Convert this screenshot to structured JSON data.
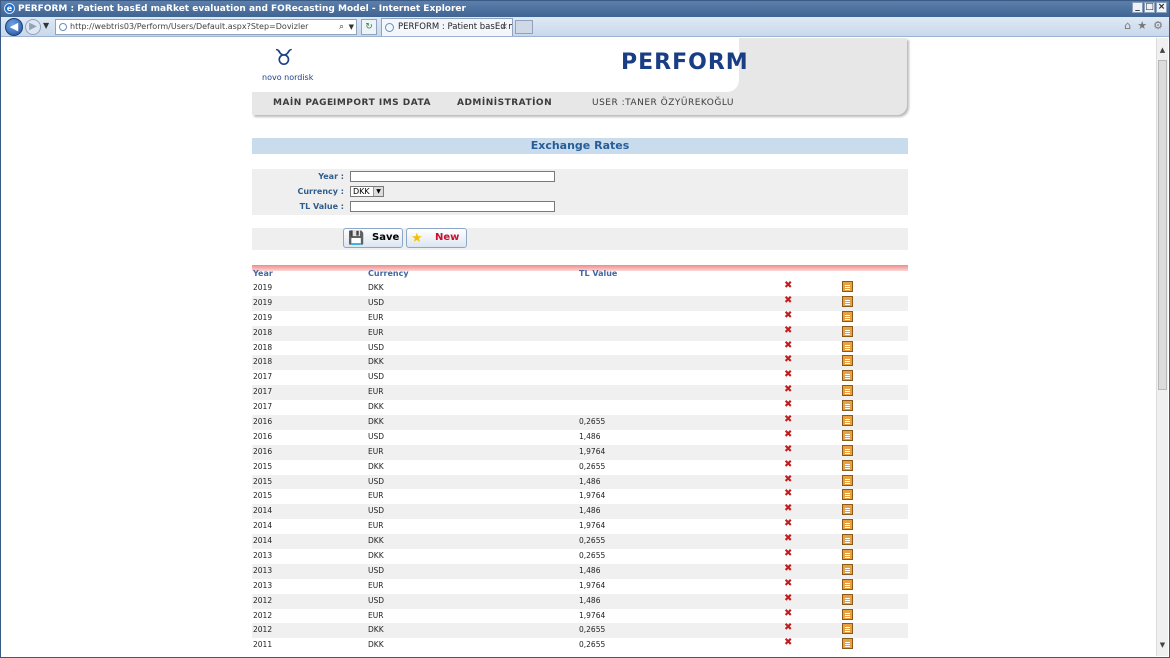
{
  "window": {
    "title": "PERFORM : Patient basEd maRket evaluation and FORecasting Model - Internet Explorer",
    "controls": [
      "_",
      "□",
      "×"
    ]
  },
  "browser": {
    "address": "http://webtris03/Perform/Users/Default.aspx?Step=Dovizler",
    "tab_title": "PERFORM : Patient basEd m...",
    "tab_close": "×"
  },
  "header": {
    "logo_brand": "novo nordisk",
    "app_name": "PERFORM",
    "menu": {
      "main_page": "MAİN PAGE",
      "import_ims": "IMPORT IMS DATA",
      "administration": "ADMİNİSTRATİON",
      "user": "USER :TANER ÖZYÜREKOĞLU"
    }
  },
  "section": {
    "title": "Exchange Rates"
  },
  "form": {
    "year_label": "Year :",
    "year_value": "",
    "currency_label": "Currency :",
    "currency_value": "DKK",
    "tl_label": "TL Value :",
    "tl_value": "",
    "save_label": "Save",
    "new_label": "New"
  },
  "table": {
    "columns": [
      "Year",
      "Currency",
      "TL Value"
    ],
    "rows": [
      {
        "year": "2019",
        "currency": "DKK",
        "tl": ""
      },
      {
        "year": "2019",
        "currency": "USD",
        "tl": ""
      },
      {
        "year": "2019",
        "currency": "EUR",
        "tl": ""
      },
      {
        "year": "2018",
        "currency": "EUR",
        "tl": ""
      },
      {
        "year": "2018",
        "currency": "USD",
        "tl": ""
      },
      {
        "year": "2018",
        "currency": "DKK",
        "tl": ""
      },
      {
        "year": "2017",
        "currency": "USD",
        "tl": ""
      },
      {
        "year": "2017",
        "currency": "EUR",
        "tl": ""
      },
      {
        "year": "2017",
        "currency": "DKK",
        "tl": ""
      },
      {
        "year": "2016",
        "currency": "DKK",
        "tl": "0,2655"
      },
      {
        "year": "2016",
        "currency": "USD",
        "tl": "1,486"
      },
      {
        "year": "2016",
        "currency": "EUR",
        "tl": "1,9764"
      },
      {
        "year": "2015",
        "currency": "DKK",
        "tl": "0,2655"
      },
      {
        "year": "2015",
        "currency": "USD",
        "tl": "1,486"
      },
      {
        "year": "2015",
        "currency": "EUR",
        "tl": "1,9764"
      },
      {
        "year": "2014",
        "currency": "USD",
        "tl": "1,486"
      },
      {
        "year": "2014",
        "currency": "EUR",
        "tl": "1,9764"
      },
      {
        "year": "2014",
        "currency": "DKK",
        "tl": "0,2655"
      },
      {
        "year": "2013",
        "currency": "DKK",
        "tl": "0,2655"
      },
      {
        "year": "2013",
        "currency": "USD",
        "tl": "1,486"
      },
      {
        "year": "2013",
        "currency": "EUR",
        "tl": "1,9764"
      },
      {
        "year": "2012",
        "currency": "USD",
        "tl": "1,486"
      },
      {
        "year": "2012",
        "currency": "EUR",
        "tl": "1,9764"
      },
      {
        "year": "2012",
        "currency": "DKK",
        "tl": "0,2655"
      },
      {
        "year": "2011",
        "currency": "DKK",
        "tl": "0,2655"
      }
    ]
  }
}
